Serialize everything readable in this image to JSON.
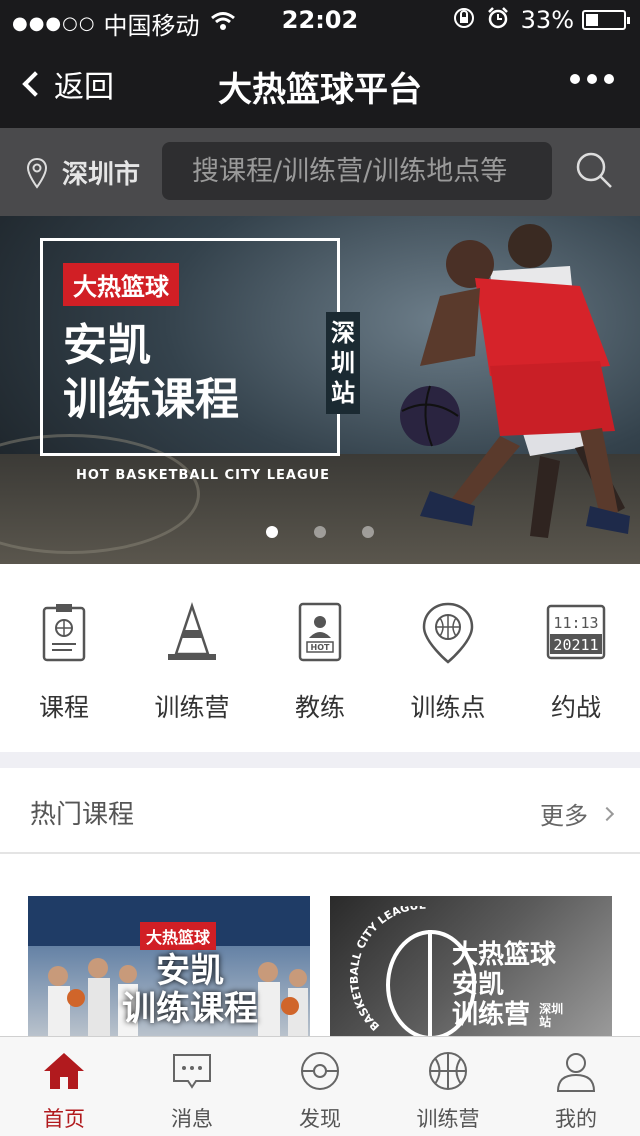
{
  "status_bar": {
    "carrier": "中国移动",
    "time": "22:02",
    "battery": "33%",
    "battery_level": 0.33
  },
  "nav": {
    "back_label": "返回",
    "title": "大热篮球平台"
  },
  "search": {
    "city": "深圳市",
    "placeholder": "搜课程/训练营/训练地点等"
  },
  "banner": {
    "brand": "大热篮球",
    "title_line1": "安凯",
    "title_line2": "训练课程",
    "vertical_text": "深圳站",
    "subtitle": "HOT BASKETBALL CITY LEAGUE",
    "slide_count": 3,
    "active_slide": 1
  },
  "categories": [
    {
      "label": "课程",
      "icon": "clipboard-icon"
    },
    {
      "label": "训练营",
      "icon": "cone-icon"
    },
    {
      "label": "教练",
      "icon": "coach-badge-icon"
    },
    {
      "label": "训练点",
      "icon": "location-ball-icon"
    },
    {
      "label": "约战",
      "icon": "scoreboard-icon"
    }
  ],
  "hot_courses": {
    "title": "热门课程",
    "more_label": "更多",
    "cards": [
      {
        "tag": "大热篮球",
        "title_line1": "安凯",
        "title_line2": "训练课程"
      },
      {
        "title_line1": "大热篮球",
        "title_line2": "安凯",
        "title_line3": "训练营",
        "badge": "深圳站",
        "arc_text": "BASKETBALL CITY LEAGUE"
      }
    ]
  },
  "tabs": [
    {
      "label": "首页",
      "icon": "home-icon",
      "active": true
    },
    {
      "label": "消息",
      "icon": "message-icon",
      "active": false
    },
    {
      "label": "发现",
      "icon": "discover-icon",
      "active": false
    },
    {
      "label": "训练营",
      "icon": "basketball-icon",
      "active": false
    },
    {
      "label": "我的",
      "icon": "profile-icon",
      "active": false
    }
  ],
  "colors": {
    "accent": "#b11a1e",
    "brand_red": "#d11f25",
    "header_bg": "#1a1a1c",
    "search_bg": "#4a4a4c"
  }
}
